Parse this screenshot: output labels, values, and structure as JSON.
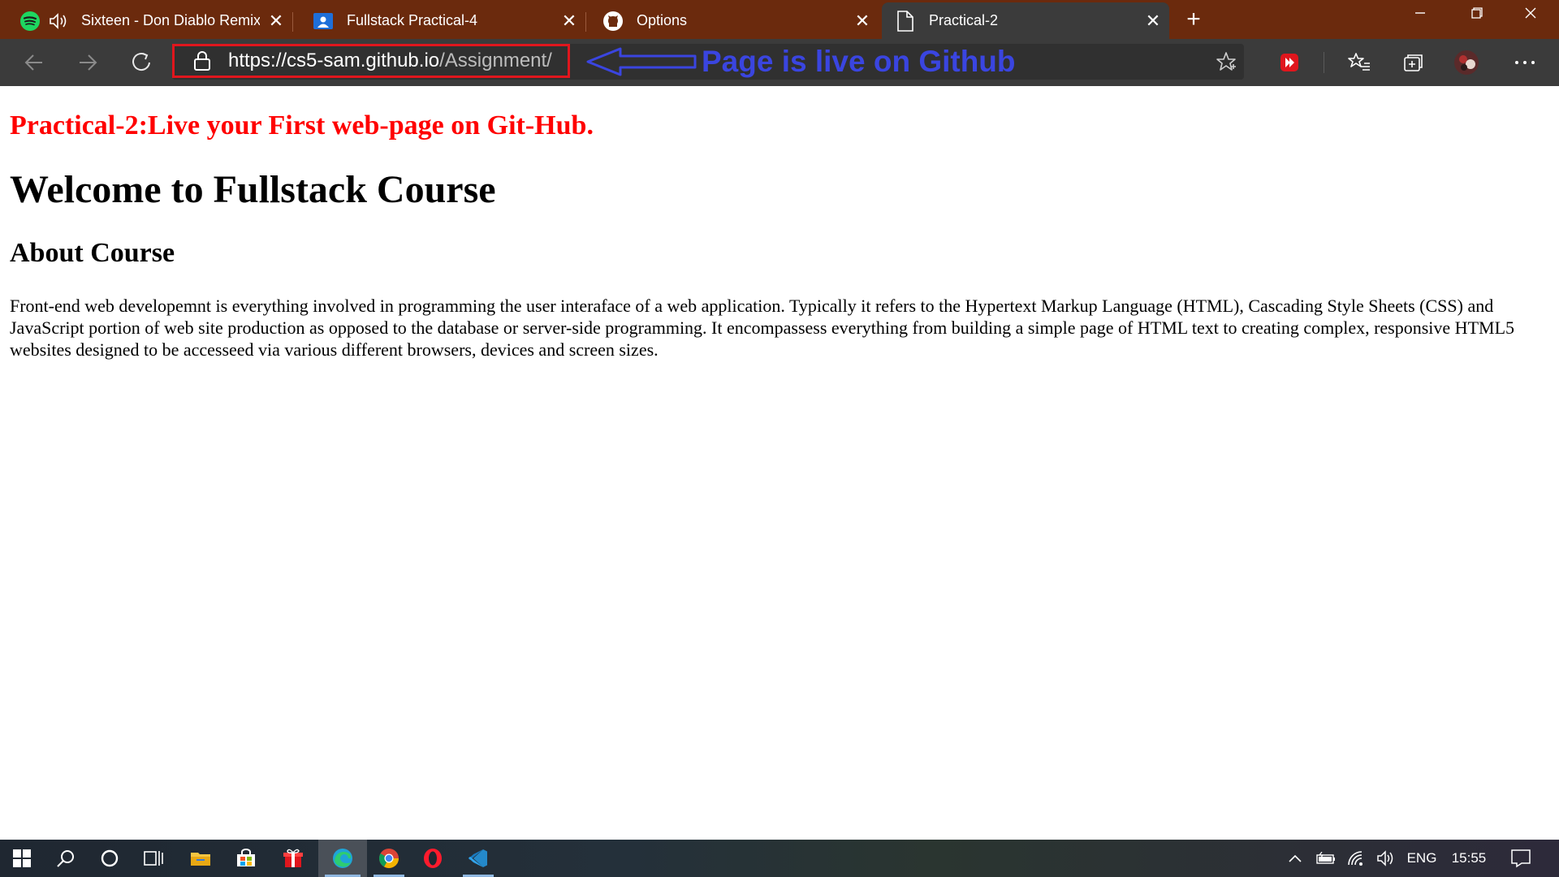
{
  "tabs": [
    {
      "label": "Sixteen - Don Diablo Remix",
      "favicon": "spotify-icon",
      "audio": true,
      "active": false
    },
    {
      "label": "Fullstack Practical-4",
      "favicon": "classroom-icon",
      "active": false
    },
    {
      "label": "Options",
      "favicon": "github-icon",
      "active": false
    },
    {
      "label": "Practical-2",
      "favicon": "page-icon",
      "active": true
    }
  ],
  "address": {
    "scheme_host": "https://cs5-sam.github.io",
    "path": "/Assignment/"
  },
  "annotation": {
    "text": "Page is live on Github",
    "color": "#3a45e0",
    "box_color": "#e0161d"
  },
  "page": {
    "practical_title": "Practical-2:Live your First web-page on Git-Hub.",
    "welcome_heading": "Welcome to Fullstack Course",
    "about_heading": "About Course",
    "description": "Front-end web developemnt is everything involved in programming the user interaface of a web application. Typically it refers to the Hypertext Markup Language (HTML), Cascading Style Sheets (CSS) and JavaScript portion of web site production as opposed to the database or server-side programming. It encompassess everything from building a simple page of HTML text to creating complex, responsive HTML5 websites designed to be accesseed via various different browsers, devices and screen sizes."
  },
  "colors": {
    "tabbar": "#6b2a0d",
    "toolbar": "#3b3b3b",
    "title_red": "#ff0000"
  },
  "taskbar": {
    "apps": [
      "windows-start-icon",
      "search-icon",
      "cortana-icon",
      "task-view-icon",
      "file-explorer-icon",
      "store-icon",
      "gift-app-icon",
      "edge-icon",
      "chrome-icon",
      "opera-icon",
      "vscode-icon"
    ],
    "language": "ENG",
    "time": "15:55"
  }
}
